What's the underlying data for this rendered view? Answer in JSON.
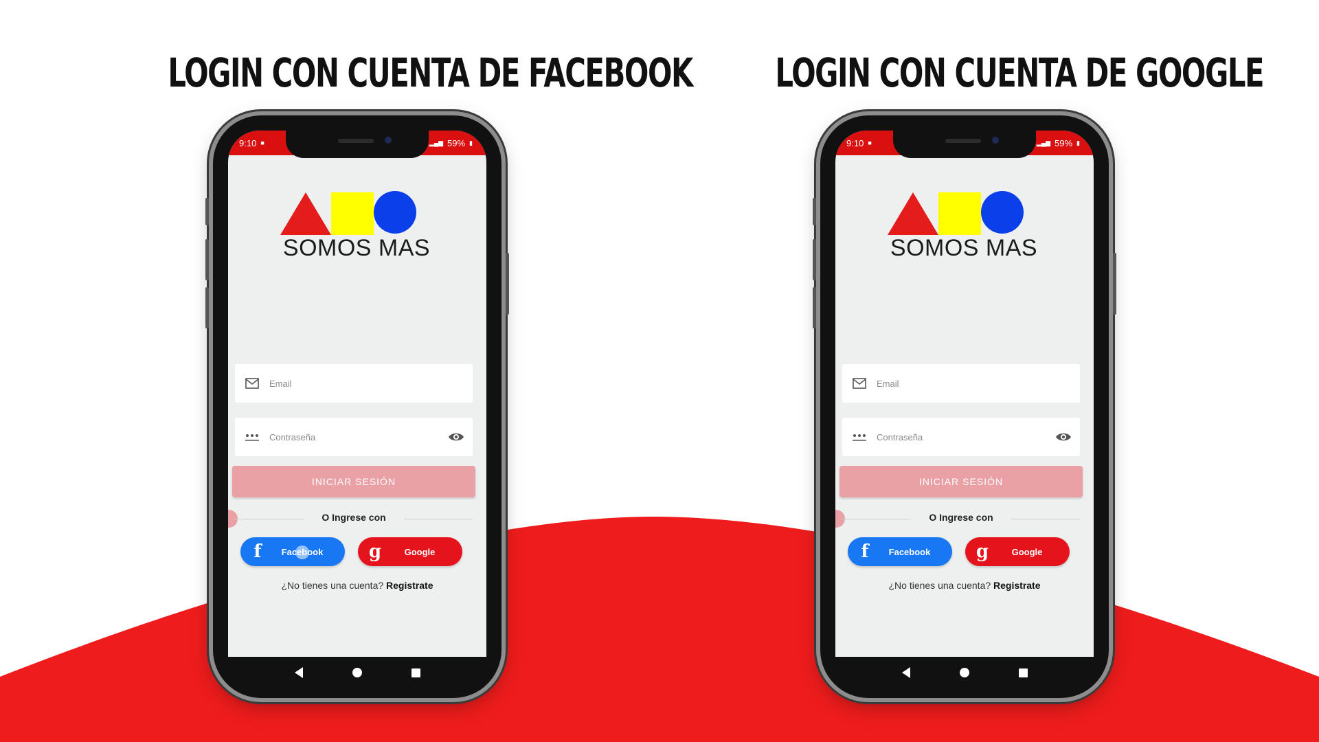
{
  "colors": {
    "accent_red": "#ee1c1c",
    "facebook_blue": "#1877f2",
    "google_red": "#e5141c",
    "login_disabled": "#eaa1a6"
  },
  "panels": [
    {
      "heading": "LOGIN CON CUENTA DE FACEBOOK",
      "status": {
        "time": "9:10",
        "battery": "59%"
      },
      "logo": {
        "brand": "SOMOS MAS"
      },
      "form": {
        "email_placeholder": "Email",
        "password_placeholder": "Contraseña",
        "login_label": "INICIAR SESIÓN",
        "divider_text": "O Ingrese con",
        "facebook_label": "Facebook",
        "google_label": "Google",
        "register_question": "¿No tienes una cuenta?",
        "register_link": "Registrate"
      }
    },
    {
      "heading": "LOGIN CON CUENTA DE GOOGLE",
      "status": {
        "time": "9:10",
        "battery": "59%"
      },
      "logo": {
        "brand": "SOMOS MAS"
      },
      "form": {
        "email_placeholder": "Email",
        "password_placeholder": "Contraseña",
        "login_label": "INICIAR SESIÓN",
        "divider_text": "O Ingrese con",
        "facebook_label": "Facebook",
        "google_label": "Google",
        "register_question": "¿No tienes una cuenta?",
        "register_link": "Registrate"
      }
    }
  ],
  "icons": {
    "email": "mail-icon",
    "password": "password-dots-icon",
    "eye": "eye-icon",
    "facebook": "facebook-f-icon",
    "google": "google-g-icon"
  }
}
